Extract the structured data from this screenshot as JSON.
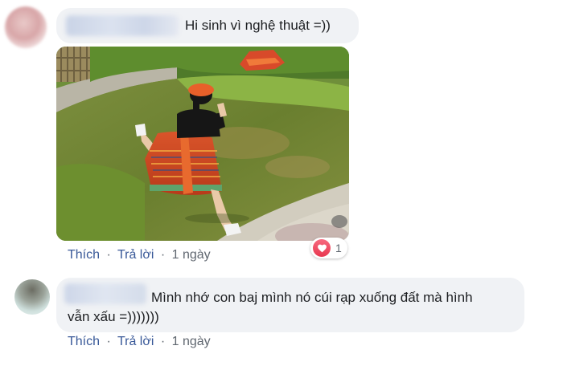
{
  "comments": [
    {
      "text": "Hi sinh vì nghệ thuật =))",
      "actions": {
        "like": "Thích",
        "reply": "Trả lời",
        "separator": "·",
        "time": "1 ngày"
      },
      "reaction": {
        "icon": "heart-icon",
        "count": "1"
      },
      "photo": {
        "description_icon": "photo"
      }
    },
    {
      "text_line1": "Mình nhớ con baj mình nó cúi rạp xuống đất mà hình",
      "text_line2": "vẫn xấu =)))))))",
      "actions": {
        "like": "Thích",
        "reply": "Trả lời",
        "separator": "·",
        "time": "1 ngày"
      }
    }
  ],
  "colors": {
    "bubble": "#f0f2f5",
    "link": "#385898",
    "meta": "#606770",
    "heart": "#e8364f"
  }
}
